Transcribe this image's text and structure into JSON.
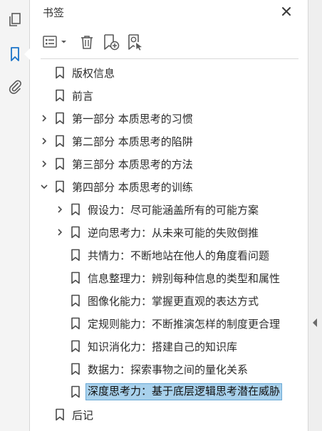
{
  "left_rail": {
    "items": [
      {
        "icon": "pages-icon",
        "active": false
      },
      {
        "icon": "bookmark-icon",
        "active": true
      },
      {
        "icon": "attachment-icon",
        "active": false
      }
    ]
  },
  "panel": {
    "title": "书签",
    "close_icon": "close-icon"
  },
  "toolbar": {
    "options_icon": "list-options-icon",
    "delete_icon": "trash-icon",
    "new_bookmark_icon": "new-bookmark-icon",
    "bookmark_from_selection_icon": "bookmark-selection-icon"
  },
  "bookmarks": [
    {
      "label": "版权信息",
      "level": 0,
      "twisty": "none",
      "selected": false
    },
    {
      "label": "前言",
      "level": 0,
      "twisty": "none",
      "selected": false
    },
    {
      "label": "第一部分 本质思考的习惯",
      "level": 0,
      "twisty": "collapsed",
      "selected": false
    },
    {
      "label": "第二部分 本质思考的陷阱",
      "level": 0,
      "twisty": "collapsed",
      "selected": false
    },
    {
      "label": "第三部分 本质思考的方法",
      "level": 0,
      "twisty": "collapsed",
      "selected": false
    },
    {
      "label": "第四部分 本质思考的训练",
      "level": 0,
      "twisty": "expanded",
      "selected": false
    },
    {
      "label": "假设力：尽可能涵盖所有的可能方案",
      "level": 1,
      "twisty": "collapsed",
      "selected": false
    },
    {
      "label": "逆向思考力：从未来可能的失败倒推",
      "level": 1,
      "twisty": "collapsed",
      "selected": false
    },
    {
      "label": "共情力：不断地站在他人的角度看问题",
      "level": 1,
      "twisty": "none",
      "selected": false
    },
    {
      "label": "信息整理力：辨别每种信息的类型和属性",
      "level": 1,
      "twisty": "none",
      "selected": false
    },
    {
      "label": "图像化能力：掌握更直观的表达方式",
      "level": 1,
      "twisty": "none",
      "selected": false
    },
    {
      "label": "定规则能力：不断推演怎样的制度更合理",
      "level": 1,
      "twisty": "none",
      "selected": false
    },
    {
      "label": "知识消化力：搭建自己的知识库",
      "level": 1,
      "twisty": "none",
      "selected": false
    },
    {
      "label": "数据力：探索事物之间的量化关系",
      "level": 1,
      "twisty": "none",
      "selected": false
    },
    {
      "label": "深度思考力：基于底层逻辑思考潜在威胁",
      "level": 1,
      "twisty": "none",
      "selected": true
    },
    {
      "label": "后记",
      "level": 0,
      "twisty": "none",
      "selected": false
    }
  ],
  "colors": {
    "accent": "#1a73c9",
    "selection": "#a8d1ec",
    "icon": "#5a5a5a"
  }
}
